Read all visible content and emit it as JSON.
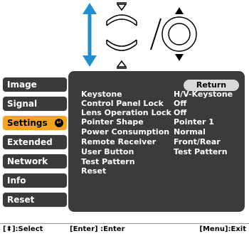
{
  "side_menu": {
    "items": [
      {
        "label": "Image"
      },
      {
        "label": "Signal"
      },
      {
        "label": "Settings"
      },
      {
        "label": "Extended"
      },
      {
        "label": "Network"
      },
      {
        "label": "Info"
      },
      {
        "label": "Reset"
      }
    ],
    "selected": "Settings"
  },
  "panel": {
    "return_label": "Return",
    "rows": [
      {
        "label": "Keystone",
        "value": "H/V-Keystone"
      },
      {
        "label": "Control Panel Lock",
        "value": "Off"
      },
      {
        "label": "Lens Operation Lock",
        "value": "Off"
      },
      {
        "label": "Pointer Shape",
        "value": "Pointer 1"
      },
      {
        "label": "Power Consumption",
        "value": "Normal"
      },
      {
        "label": "Remote Receiver",
        "value": "Front/Rear"
      },
      {
        "label": "User Button",
        "value": "Test Pattern"
      },
      {
        "label": "Test Pattern",
        "value": ""
      },
      {
        "label": "Reset",
        "value": ""
      }
    ]
  },
  "help_bar": {
    "select": "[⬍]:Select",
    "enter": "[Enter] :Enter",
    "exit": "[Menu]:Exit"
  },
  "colors": {
    "accent": "#f6a41e",
    "arrow": "#1e90d0",
    "panel": "#3b3b3b",
    "tab": "#3a3a3a"
  },
  "icons": [
    "up-down-arrow-icon",
    "keystone-up-button-icon",
    "keystone-down-button-icon",
    "dpad-icon",
    "enter-icon"
  ]
}
